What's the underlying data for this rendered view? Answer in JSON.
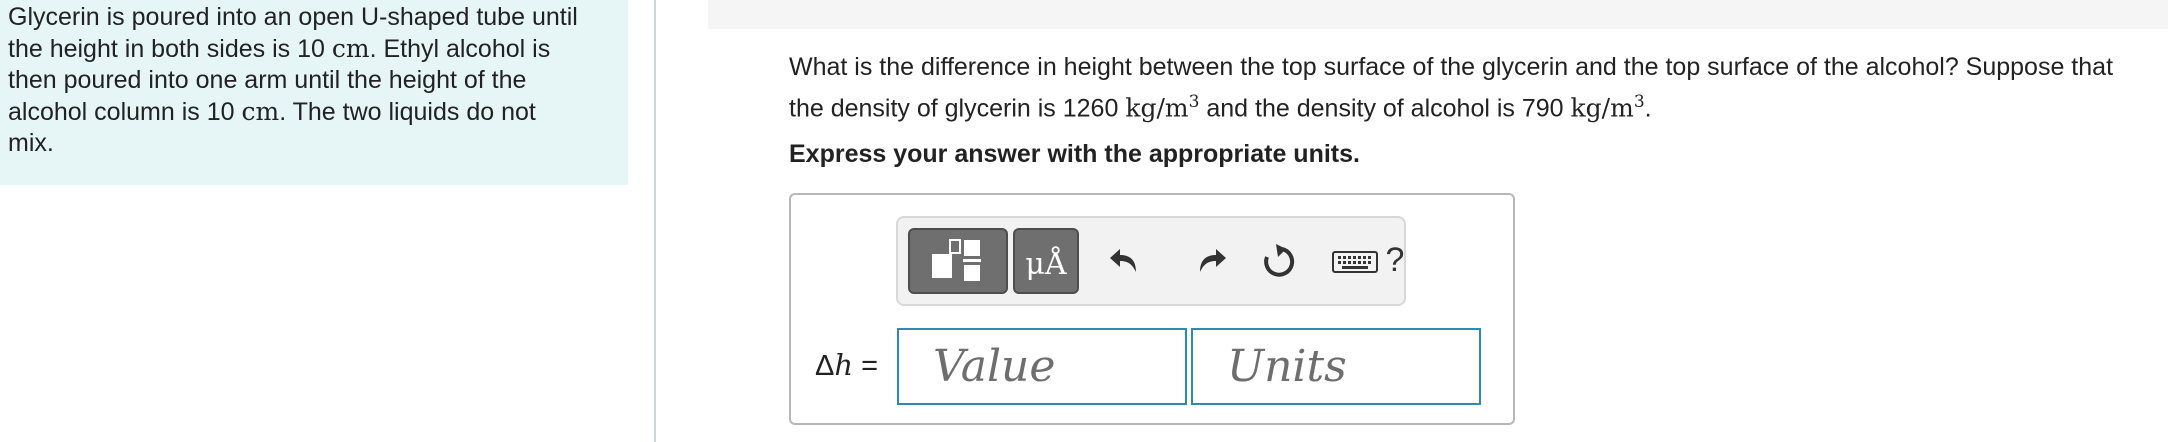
{
  "problem": {
    "intro_1": "Glycerin is poured into an open U-shaped tube until",
    "intro_2": "the height in both sides is 10",
    "unit_cm": "cm",
    "intro_3": ". Ethyl alcohol is",
    "intro_4": "then poured into one arm until the height of the",
    "intro_5": "alcohol column is 10",
    "intro_6": ". The two liquids do not",
    "intro_7": "mix."
  },
  "question": {
    "line1": "What is the difference in height between the top surface of the glycerin and the top surface of the alcohol? Suppose that",
    "line2_a": "the density of glycerin is 1260",
    "density_unit": "kg/m",
    "exponent": "3",
    "line2_b": "and the density of alcohol is 790",
    "line2_c": "."
  },
  "instruction": "Express your answer with the appropriate units.",
  "toolbar": {
    "units_label": "μÅ",
    "help_label": "?"
  },
  "answer": {
    "variable_symbol": "Δ",
    "variable_letter": "h",
    "equals": "=",
    "value_placeholder": "Value",
    "units_placeholder": "Units"
  },
  "colors": {
    "panel_bg": "#e6f5f5",
    "input_border": "#2e8bb0",
    "tool_button": "#6f6f6f"
  }
}
